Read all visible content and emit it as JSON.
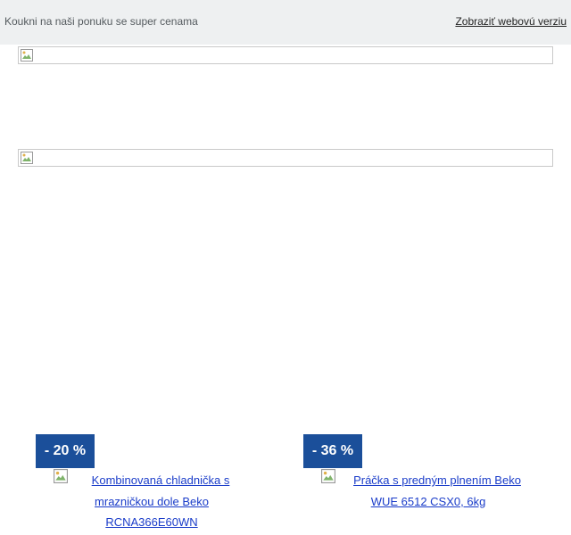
{
  "preheader": {
    "text": "Koukni na naši ponuku se super cenama",
    "web_link": "Zobraziť webovú verziu"
  },
  "products": [
    {
      "discount": "- 20 %",
      "name_lines": [
        "Kombinovaná chladnička s",
        "mrazničkou dole Beko",
        "RCNA366E60WN"
      ]
    },
    {
      "discount": "- 36 %",
      "name_lines": [
        "Práčka s predným plnením Beko",
        "WUE 6512 CSX0, 6kg"
      ]
    }
  ],
  "colors": {
    "preheader_bg": "#eef0f1",
    "badge_bg": "#1b4f9a",
    "link": "#1a3cc9"
  }
}
